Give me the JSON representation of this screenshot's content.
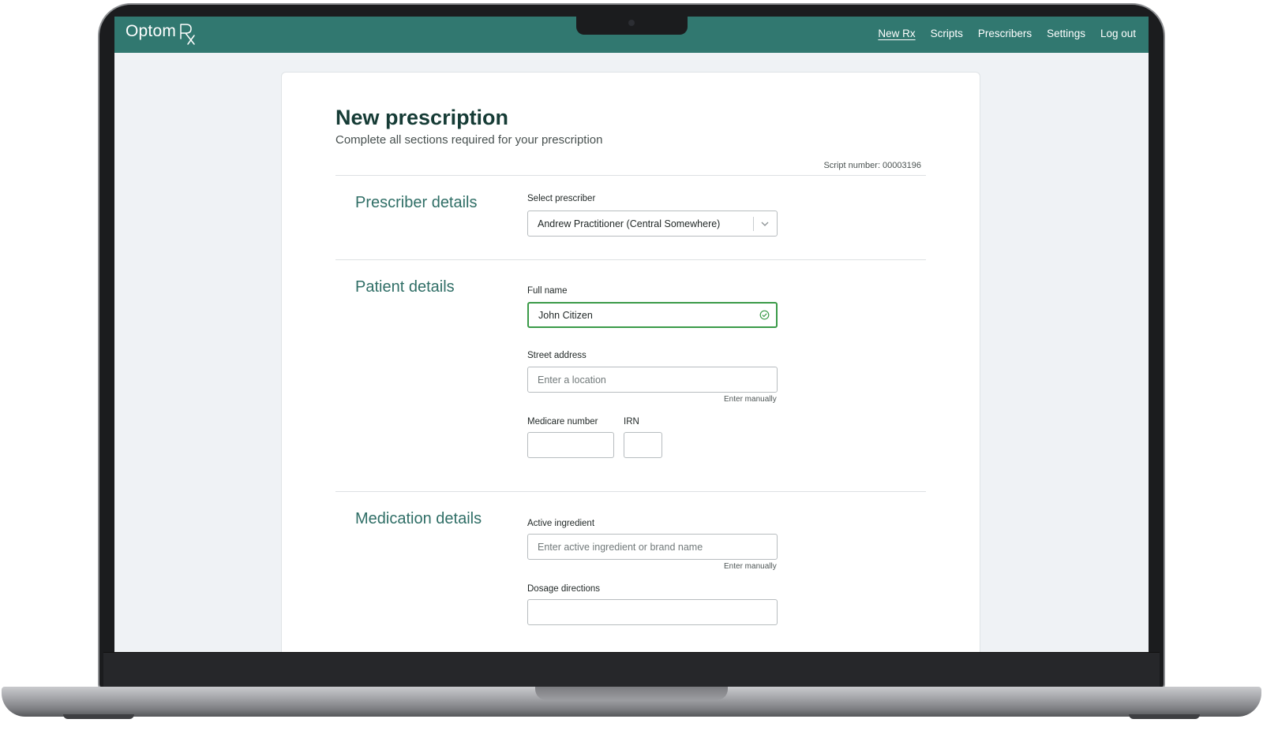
{
  "app": {
    "logo_text": "Optom",
    "logo_mark": "Rx"
  },
  "nav": {
    "items": [
      {
        "label": "New Rx",
        "active": true
      },
      {
        "label": "Scripts",
        "active": false
      },
      {
        "label": "Prescribers",
        "active": false
      },
      {
        "label": "Settings",
        "active": false
      },
      {
        "label": "Log out",
        "active": false
      }
    ]
  },
  "page": {
    "title": "New prescription",
    "subtitle": "Complete all sections required for your prescription",
    "script_number": "Script number: 00003196"
  },
  "prescriber": {
    "section_title": "Prescriber details",
    "select_label": "Select prescriber",
    "selected_value": "Andrew Practitioner (Central Somewhere)"
  },
  "patient": {
    "section_title": "Patient details",
    "full_name_label": "Full name",
    "full_name_value": "John Citizen",
    "street_label": "Street address",
    "street_placeholder": "Enter a location",
    "street_helper": "Enter manually",
    "medicare_label": "Medicare number",
    "irn_label": "IRN"
  },
  "medication": {
    "section_title": "Medication details",
    "ingredient_label": "Active ingredient",
    "ingredient_placeholder": "Enter active ingredient or brand name",
    "ingredient_helper": "Enter manually",
    "dosage_label": "Dosage directions"
  },
  "colors": {
    "brand": "#317870",
    "valid": "#3a9a48",
    "section_title": "#2f6e66"
  },
  "icons": {
    "select_chevron": "chevron-down-icon",
    "valid_check": "check-circle-icon"
  }
}
